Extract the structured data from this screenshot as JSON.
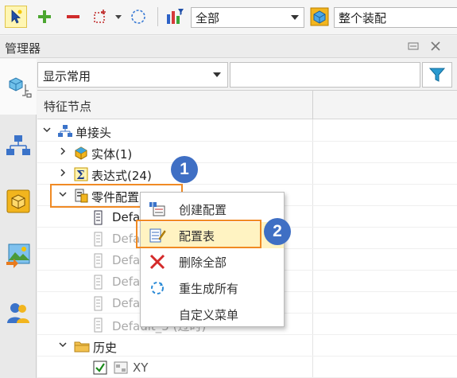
{
  "toolbar": {
    "filter_value": "全部",
    "scope_value": "整个装配"
  },
  "manager": {
    "title": "管理器"
  },
  "filter": {
    "display_value": "显示常用"
  },
  "tree": {
    "column_header": "特征节点",
    "nodes": {
      "root": "单接头",
      "solid": "实体(1)",
      "expr": "表达式(24)",
      "config": "零件配置(6)",
      "default1": "Defa",
      "default2": "Defa",
      "default3": "Defa",
      "default4": "Defa",
      "default5": "Defa",
      "default6": "Default_5 (过时)",
      "history": "历史",
      "xy": "XY"
    }
  },
  "context_menu": {
    "items": [
      {
        "label": "创建配置"
      },
      {
        "label": "配置表"
      },
      {
        "label": "删除全部"
      },
      {
        "label": "重生成所有"
      },
      {
        "label": "自定义菜单"
      }
    ]
  },
  "callouts": {
    "one": "1",
    "two": "2"
  },
  "colors": {
    "highlight": "#f08a24",
    "badge": "#3f6fc4",
    "menu_hover": "#fff3c2"
  }
}
